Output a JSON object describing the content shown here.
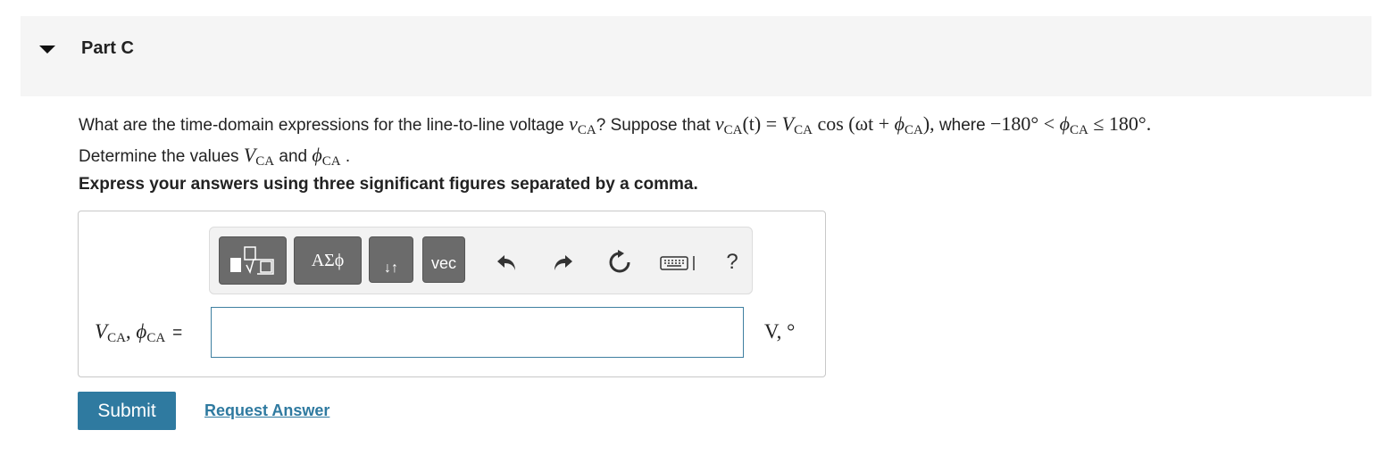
{
  "part": {
    "title": "Part C"
  },
  "question": {
    "line1_prefix": "What are the time-domain expressions for the line-to-line voltage ",
    "var_v": "v",
    "sub_CA": "CA",
    "line1_mid": "? Suppose that ",
    "func_arg": "(t) = ",
    "V": "V",
    "cos_text": " cos (ωt + ",
    "phi": "ϕ",
    "close_paren": "),",
    "where": " where ",
    "range_left": "−180° < ",
    "range_right": " ≤ 180°.",
    "line2_prefix": "Determine the values ",
    "and": " and ",
    "period": " ."
  },
  "instruction": "Express your answers using three significant figures separated by a comma.",
  "toolbar": {
    "greek_label": "ΑΣϕ",
    "arrows_label": "↓↑",
    "vec_label": "vec",
    "help_label": "?"
  },
  "answer": {
    "label_V": "V",
    "label_sub": "CA",
    "label_sep": ", ",
    "label_phi": "ϕ",
    "equals": "=",
    "value": "",
    "units": "V, °"
  },
  "buttons": {
    "submit": "Submit",
    "request": "Request Answer"
  }
}
